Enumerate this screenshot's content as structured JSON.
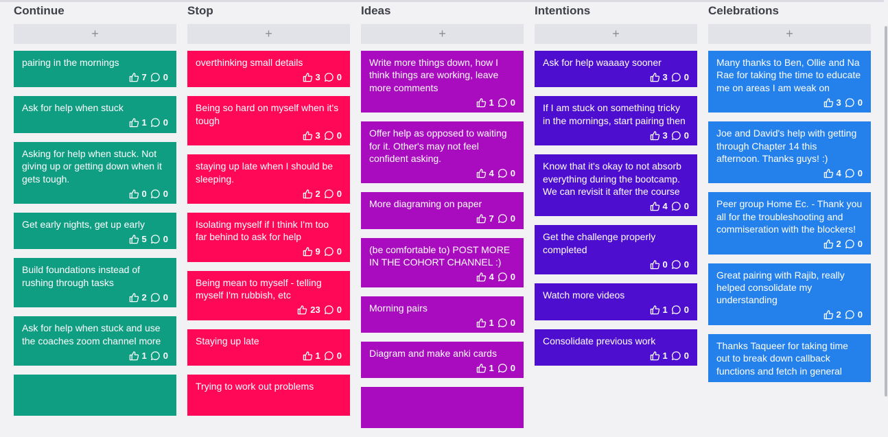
{
  "colors": {
    "Continue": "#109e82",
    "Stop": "#ff0858",
    "Ideas": "#a80cbe",
    "Intentions": "#4d0ed0",
    "Celebrations": "#2480ea"
  },
  "add_symbol": "+",
  "columns": [
    {
      "title": "Continue",
      "color_key": "Continue",
      "cards": [
        {
          "text": "pairing in the mornings",
          "likes": "7",
          "comments": "0"
        },
        {
          "text": "Ask for help when stuck",
          "likes": "1",
          "comments": "0"
        },
        {
          "text": "Asking for help when stuck. Not giving up or getting down when it gets tough.",
          "likes": "0",
          "comments": "0"
        },
        {
          "text": "Get early nights, get up early",
          "likes": "5",
          "comments": "0"
        },
        {
          "text": "Build foundations instead of rushing through tasks",
          "likes": "2",
          "comments": "0"
        },
        {
          "text": "Ask for help when stuck and use the coaches zoom channel more",
          "likes": "1",
          "comments": "0"
        },
        {
          "text": "",
          "likes": "",
          "comments": ""
        }
      ]
    },
    {
      "title": "Stop",
      "color_key": "Stop",
      "cards": [
        {
          "text": "overthinking small details",
          "likes": "3",
          "comments": "0"
        },
        {
          "text": "Being so hard on myself when it's tough",
          "likes": "3",
          "comments": "0"
        },
        {
          "text": "staying up late when I should be sleeping.",
          "likes": "2",
          "comments": "0"
        },
        {
          "text": "Isolating myself if I think I'm too far behind to ask for help",
          "likes": "9",
          "comments": "0"
        },
        {
          "text": "Being mean to myself - telling myself I'm rubbish, etc",
          "likes": "23",
          "comments": "0"
        },
        {
          "text": "Staying up late",
          "likes": "1",
          "comments": "0"
        },
        {
          "text": "Trying to work out problems",
          "likes": "",
          "comments": ""
        }
      ]
    },
    {
      "title": "Ideas",
      "color_key": "Ideas",
      "cards": [
        {
          "text": "Write more things down, how I think things are working, leave more comments",
          "likes": "1",
          "comments": "0"
        },
        {
          "text": "Offer help as opposed to waiting for it. Other's may not feel confident asking.",
          "likes": "4",
          "comments": "0"
        },
        {
          "text": "More diagraming on paper",
          "likes": "7",
          "comments": "0"
        },
        {
          "text": "(be comfortable to) POST MORE IN THE COHORT CHANNEL :)",
          "likes": "4",
          "comments": "0"
        },
        {
          "text": "Morning pairs",
          "likes": "1",
          "comments": "0"
        },
        {
          "text": "Diagram and make anki cards",
          "likes": "1",
          "comments": "0"
        },
        {
          "text": "",
          "likes": "",
          "comments": ""
        }
      ]
    },
    {
      "title": "Intentions",
      "color_key": "Intentions",
      "cards": [
        {
          "text": "Ask for help waaaay sooner",
          "likes": "3",
          "comments": "0"
        },
        {
          "text": "If I am stuck on something tricky in the mornings, start pairing then",
          "likes": "3",
          "comments": "0"
        },
        {
          "text": "Know that it's okay to not absorb everything during the bootcamp. We can revisit it after the course",
          "likes": "4",
          "comments": "0"
        },
        {
          "text": "Get the challenge properly completed",
          "likes": "0",
          "comments": "0"
        },
        {
          "text": "Watch more videos",
          "likes": "1",
          "comments": "0"
        },
        {
          "text": "Consolidate previous work",
          "likes": "1",
          "comments": "0"
        }
      ]
    },
    {
      "title": "Celebrations",
      "color_key": "Celebrations",
      "cards": [
        {
          "text": "Many thanks to Ben, Ollie and Na Rae for taking the time to educate me on areas I am weak on",
          "likes": "3",
          "comments": "0"
        },
        {
          "text": "Joe and David's help with getting through Chapter 14 this afternoon. Thanks guys! :)",
          "likes": "4",
          "comments": "0"
        },
        {
          "text": "Peer group Home Ec. - Thank you all for the troubleshooting and commiseration with the blockers!",
          "likes": "2",
          "comments": "0"
        },
        {
          "text": "Great pairing with Rajib, really helped consolidate my understanding",
          "likes": "2",
          "comments": "0"
        },
        {
          "text": "Thanks Taqueer for taking time out to break down callback functions and fetch in general",
          "likes": "",
          "comments": ""
        }
      ]
    }
  ]
}
